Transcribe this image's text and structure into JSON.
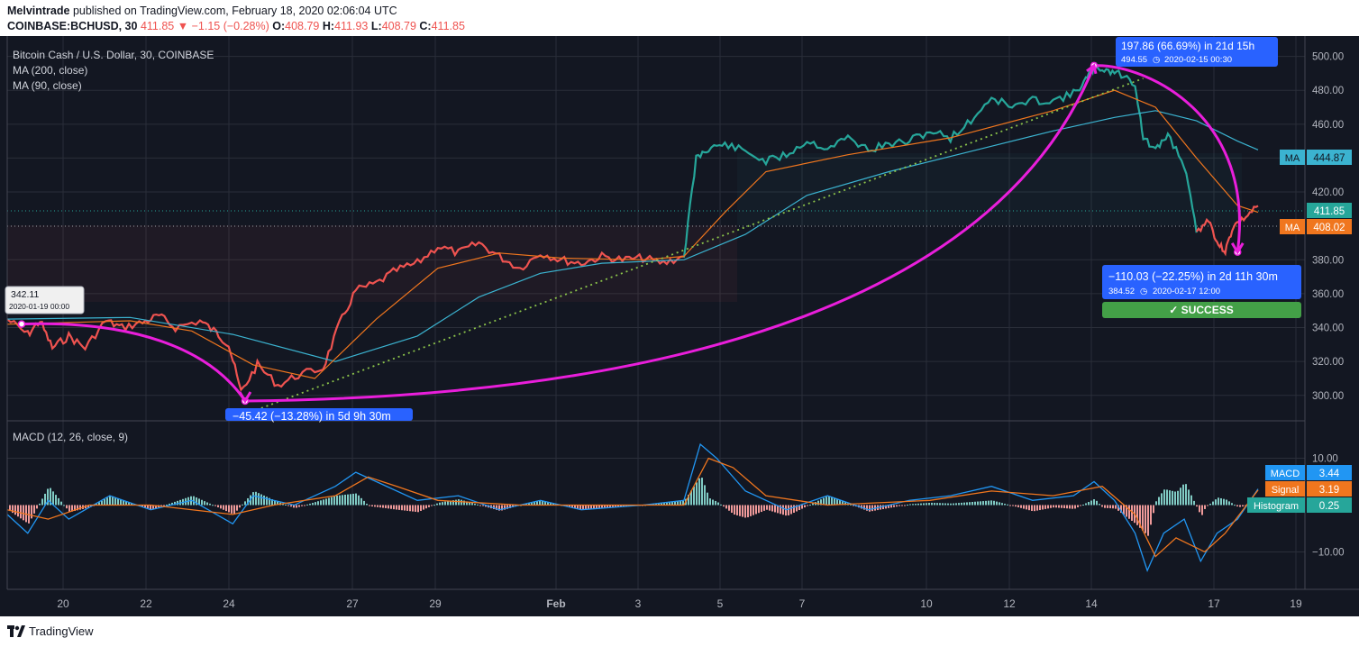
{
  "header": {
    "publisher": "Melvintrade",
    "published_text": " published on TradingView.com, February 18, 2020 02:06:04 UTC",
    "symbol": "COINBASE:BCHUSD, 30",
    "last": "411.85",
    "change": "−1.15 (−0.28%)",
    "o_label": "O:",
    "o": "408.79",
    "h_label": "H:",
    "h": "411.93",
    "l_label": "L:",
    "l": "408.79",
    "c_label": "C:",
    "c": "411.85"
  },
  "legend": {
    "title": "Bitcoin Cash / U.S. Dollar, 30, COINBASE",
    "ma200": "MA (200, close)",
    "ma90": "MA (90, close)",
    "macd": "MACD (12, 26, close, 9)"
  },
  "price_axis": [
    "500.00",
    "480.00",
    "460.00",
    "440.00",
    "420.00",
    "380.00",
    "360.00",
    "340.00",
    "320.00",
    "300.00"
  ],
  "macd_axis": [
    "10.00",
    "−10.00"
  ],
  "time_axis": [
    "20",
    "22",
    "24",
    "27",
    "29",
    "Feb",
    "3",
    "5",
    "7",
    "10",
    "12",
    "14",
    "17",
    "19"
  ],
  "badges": {
    "ma_label": "MA",
    "ma1_value": "444.87",
    "last_value": "411.85",
    "ma2_value": "408.02",
    "macd_label": "MACD",
    "macd_value": "3.44",
    "signal_label": "Signal",
    "signal_value": "3.19",
    "hist_label": "Histogram",
    "hist_value": "0.25"
  },
  "annotations": {
    "start_price": "342.11",
    "start_date": "2020-01-19 00:00",
    "low1_text": "−45.42 (−13.28%) in 5d 9h 30m",
    "peak_text": "197.86 (66.69%) in 21d 15h",
    "peak_sub": "494.55",
    "peak_date": "2020-02-15  00:30",
    "drop_text": "−110.03 (−22.25%) in 2d 11h 30m",
    "drop_sub": "384.52",
    "drop_date": "2020-02-17  12:00",
    "success": "✓ SUCCESS"
  },
  "colors": {
    "bg": "#131722",
    "grid": "#2a2e39",
    "up": "#26a69a",
    "down": "#ef5350",
    "ma200": "#3bb3d0",
    "ma90": "#f0761e",
    "arrow": "#e91edb",
    "trend": "#8bc34a",
    "label_blue": "#2962ff",
    "success": "#43a047"
  },
  "footer": {
    "brand": "TradingView"
  },
  "chart_data": {
    "type": "line",
    "title": "Bitcoin Cash / U.S. Dollar, 30, COINBASE",
    "ylim": [
      285,
      512
    ],
    "price_series": [
      {
        "x": 18.5,
        "y": 345
      },
      {
        "x": 19.0,
        "y": 336
      },
      {
        "x": 19.3,
        "y": 344
      },
      {
        "x": 19.6,
        "y": 328
      },
      {
        "x": 20.0,
        "y": 335
      },
      {
        "x": 20.4,
        "y": 328
      },
      {
        "x": 20.9,
        "y": 344
      },
      {
        "x": 21.3,
        "y": 340
      },
      {
        "x": 21.8,
        "y": 343
      },
      {
        "x": 22.2,
        "y": 347
      },
      {
        "x": 22.6,
        "y": 340
      },
      {
        "x": 23.2,
        "y": 344
      },
      {
        "x": 23.6,
        "y": 337
      },
      {
        "x": 23.9,
        "y": 330
      },
      {
        "x": 24.2,
        "y": 302
      },
      {
        "x": 24.6,
        "y": 318
      },
      {
        "x": 25.1,
        "y": 306
      },
      {
        "x": 25.6,
        "y": 312
      },
      {
        "x": 26.2,
        "y": 316
      },
      {
        "x": 26.6,
        "y": 342
      },
      {
        "x": 27.0,
        "y": 362
      },
      {
        "x": 27.5,
        "y": 366
      },
      {
        "x": 28.0,
        "y": 374
      },
      {
        "x": 28.5,
        "y": 378
      },
      {
        "x": 29.0,
        "y": 388
      },
      {
        "x": 29.5,
        "y": 384
      },
      {
        "x": 30.0,
        "y": 390
      },
      {
        "x": 30.5,
        "y": 382
      },
      {
        "x": 31.0,
        "y": 375
      },
      {
        "x": 31.5,
        "y": 384
      },
      {
        "x": 32.0,
        "y": 380
      },
      {
        "x": 32.5,
        "y": 378
      },
      {
        "x": 33.0,
        "y": 382
      },
      {
        "x": 33.5,
        "y": 380
      },
      {
        "x": 34.0,
        "y": 381
      },
      {
        "x": 34.5,
        "y": 378
      },
      {
        "x": 35.0,
        "y": 382
      },
      {
        "x": 35.3,
        "y": 440
      },
      {
        "x": 35.6,
        "y": 446
      },
      {
        "x": 36.0,
        "y": 448
      },
      {
        "x": 36.5,
        "y": 444
      },
      {
        "x": 37.0,
        "y": 438
      },
      {
        "x": 37.5,
        "y": 442
      },
      {
        "x": 38.0,
        "y": 450
      },
      {
        "x": 38.5,
        "y": 446
      },
      {
        "x": 39.0,
        "y": 452
      },
      {
        "x": 39.5,
        "y": 445
      },
      {
        "x": 40.0,
        "y": 448
      },
      {
        "x": 40.5,
        "y": 450
      },
      {
        "x": 41.0,
        "y": 456
      },
      {
        "x": 41.5,
        "y": 452
      },
      {
        "x": 42.0,
        "y": 462
      },
      {
        "x": 42.5,
        "y": 476
      },
      {
        "x": 43.0,
        "y": 470
      },
      {
        "x": 43.5,
        "y": 474
      },
      {
        "x": 44.0,
        "y": 474
      },
      {
        "x": 44.5,
        "y": 478
      },
      {
        "x": 44.8,
        "y": 486
      },
      {
        "x": 45.0,
        "y": 494
      },
      {
        "x": 45.3,
        "y": 492
      },
      {
        "x": 45.6,
        "y": 490
      },
      {
        "x": 46.0,
        "y": 484
      },
      {
        "x": 46.2,
        "y": 452
      },
      {
        "x": 46.5,
        "y": 444
      },
      {
        "x": 46.8,
        "y": 454
      },
      {
        "x": 47.2,
        "y": 436
      },
      {
        "x": 47.5,
        "y": 396
      },
      {
        "x": 47.8,
        "y": 404
      },
      {
        "x": 48.0,
        "y": 390
      },
      {
        "x": 48.2,
        "y": 385
      },
      {
        "x": 48.4,
        "y": 400
      },
      {
        "x": 48.7,
        "y": 405
      },
      {
        "x": 49.0,
        "y": 411.85
      }
    ],
    "ma200_series": [
      {
        "x": 18.5,
        "y": 345
      },
      {
        "x": 21.5,
        "y": 346
      },
      {
        "x": 24.0,
        "y": 336
      },
      {
        "x": 26.5,
        "y": 320
      },
      {
        "x": 28.5,
        "y": 335
      },
      {
        "x": 30.0,
        "y": 358
      },
      {
        "x": 31.5,
        "y": 372
      },
      {
        "x": 33.0,
        "y": 378
      },
      {
        "x": 35.0,
        "y": 380
      },
      {
        "x": 36.5,
        "y": 395
      },
      {
        "x": 38.0,
        "y": 418
      },
      {
        "x": 40.0,
        "y": 432
      },
      {
        "x": 42.0,
        "y": 444
      },
      {
        "x": 44.0,
        "y": 456
      },
      {
        "x": 45.5,
        "y": 464
      },
      {
        "x": 46.5,
        "y": 468
      },
      {
        "x": 47.5,
        "y": 462
      },
      {
        "x": 48.5,
        "y": 450
      },
      {
        "x": 49.0,
        "y": 444.87
      }
    ],
    "ma90_series": [
      {
        "x": 18.5,
        "y": 342
      },
      {
        "x": 21.5,
        "y": 344
      },
      {
        "x": 23.0,
        "y": 338
      },
      {
        "x": 24.5,
        "y": 318
      },
      {
        "x": 26.0,
        "y": 310
      },
      {
        "x": 27.5,
        "y": 345
      },
      {
        "x": 29.0,
        "y": 375
      },
      {
        "x": 30.5,
        "y": 384
      },
      {
        "x": 32.0,
        "y": 381
      },
      {
        "x": 34.0,
        "y": 380
      },
      {
        "x": 35.0,
        "y": 382
      },
      {
        "x": 36.0,
        "y": 408
      },
      {
        "x": 37.0,
        "y": 432
      },
      {
        "x": 39.0,
        "y": 442
      },
      {
        "x": 41.5,
        "y": 452
      },
      {
        "x": 44.0,
        "y": 468
      },
      {
        "x": 45.5,
        "y": 480
      },
      {
        "x": 46.5,
        "y": 470
      },
      {
        "x": 47.5,
        "y": 440
      },
      {
        "x": 48.5,
        "y": 412
      },
      {
        "x": 49.0,
        "y": 408.02
      }
    ],
    "trend_line": [
      {
        "x": 24.2,
        "y": 288
      },
      {
        "x": 46.2,
        "y": 487
      }
    ],
    "measures": [
      {
        "from": {
          "x": 18.5,
          "y": 342.11
        },
        "to": {
          "x": 24.3,
          "y": 296.69
        }
      },
      {
        "from": {
          "x": 24.3,
          "y": 296.69
        },
        "to": {
          "x": 45.0,
          "y": 494.55
        }
      },
      {
        "from": {
          "x": 45.0,
          "y": 494.55
        },
        "to": {
          "x": 48.5,
          "y": 384.52
        }
      }
    ],
    "macd": {
      "ylim": [
        -18,
        18
      ],
      "macd_line": [
        {
          "x": 18.5,
          "y": -2
        },
        {
          "x": 19.0,
          "y": -6
        },
        {
          "x": 19.5,
          "y": 1
        },
        {
          "x": 20.0,
          "y": -3
        },
        {
          "x": 21.0,
          "y": 2
        },
        {
          "x": 22.0,
          "y": -1
        },
        {
          "x": 23.0,
          "y": 1
        },
        {
          "x": 24.0,
          "y": -4
        },
        {
          "x": 24.5,
          "y": 2
        },
        {
          "x": 25.5,
          "y": 0
        },
        {
          "x": 26.5,
          "y": 4
        },
        {
          "x": 27.0,
          "y": 7
        },
        {
          "x": 27.5,
          "y": 5
        },
        {
          "x": 28.5,
          "y": 1
        },
        {
          "x": 29.5,
          "y": 2
        },
        {
          "x": 30.5,
          "y": -1
        },
        {
          "x": 31.5,
          "y": 1
        },
        {
          "x": 32.5,
          "y": -1
        },
        {
          "x": 34.0,
          "y": 0
        },
        {
          "x": 35.0,
          "y": 1
        },
        {
          "x": 35.4,
          "y": 13
        },
        {
          "x": 35.8,
          "y": 10
        },
        {
          "x": 36.5,
          "y": 3
        },
        {
          "x": 37.5,
          "y": -1
        },
        {
          "x": 38.5,
          "y": 2
        },
        {
          "x": 39.5,
          "y": -1
        },
        {
          "x": 40.5,
          "y": 1
        },
        {
          "x": 41.5,
          "y": 2
        },
        {
          "x": 42.5,
          "y": 4
        },
        {
          "x": 43.5,
          "y": 1
        },
        {
          "x": 44.5,
          "y": 2
        },
        {
          "x": 45.0,
          "y": 5
        },
        {
          "x": 45.5,
          "y": 1
        },
        {
          "x": 46.0,
          "y": -6
        },
        {
          "x": 46.3,
          "y": -14
        },
        {
          "x": 46.7,
          "y": -6
        },
        {
          "x": 47.2,
          "y": -3
        },
        {
          "x": 47.6,
          "y": -12
        },
        {
          "x": 48.0,
          "y": -6
        },
        {
          "x": 48.5,
          "y": -3
        },
        {
          "x": 49.0,
          "y": 3.44
        }
      ],
      "signal_line": [
        {
          "x": 18.5,
          "y": -1
        },
        {
          "x": 19.5,
          "y": -3
        },
        {
          "x": 20.5,
          "y": 0
        },
        {
          "x": 22.0,
          "y": 0
        },
        {
          "x": 24.0,
          "y": -2
        },
        {
          "x": 25.0,
          "y": 0
        },
        {
          "x": 26.5,
          "y": 2
        },
        {
          "x": 27.3,
          "y": 6
        },
        {
          "x": 28.0,
          "y": 4
        },
        {
          "x": 29.0,
          "y": 1
        },
        {
          "x": 31.0,
          "y": 0
        },
        {
          "x": 34.0,
          "y": 0
        },
        {
          "x": 35.0,
          "y": 0
        },
        {
          "x": 35.6,
          "y": 10
        },
        {
          "x": 36.2,
          "y": 8
        },
        {
          "x": 37.0,
          "y": 2
        },
        {
          "x": 38.5,
          "y": 0
        },
        {
          "x": 41.0,
          "y": 1
        },
        {
          "x": 42.5,
          "y": 3
        },
        {
          "x": 44.0,
          "y": 2
        },
        {
          "x": 45.2,
          "y": 4
        },
        {
          "x": 46.0,
          "y": -2
        },
        {
          "x": 46.5,
          "y": -11
        },
        {
          "x": 47.0,
          "y": -7
        },
        {
          "x": 47.7,
          "y": -10
        },
        {
          "x": 48.2,
          "y": -6
        },
        {
          "x": 49.0,
          "y": 3.19
        }
      ]
    }
  }
}
